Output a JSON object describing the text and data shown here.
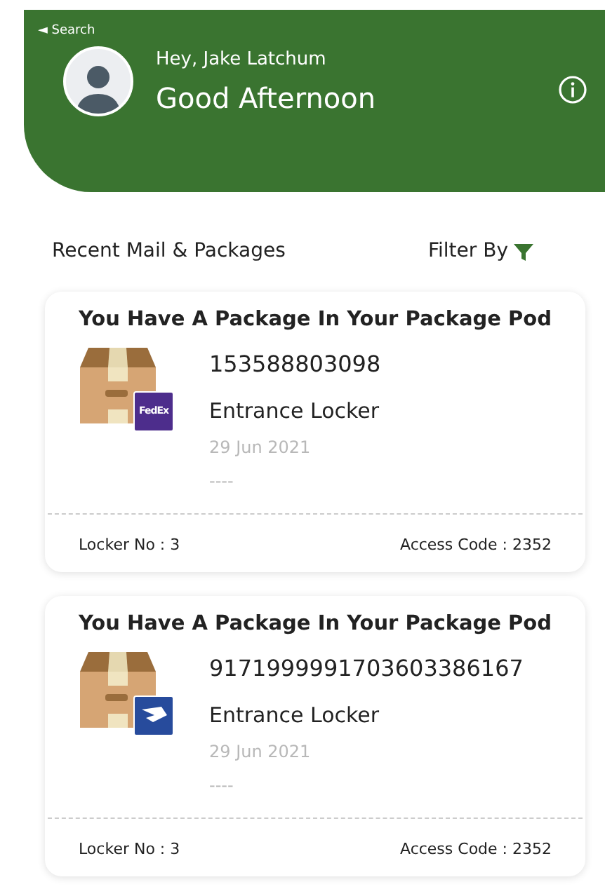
{
  "status_bar": {
    "back_label": "◄ Search"
  },
  "header": {
    "greeting": "Hey, Jake Latchum",
    "salutation": "Good Afternoon"
  },
  "section": {
    "title": "Recent Mail & Packages",
    "filter_label": "Filter By"
  },
  "packages": [
    {
      "title": "You Have A Package In Your Package Pod",
      "tracking": "153588803098",
      "location": "Entrance Locker",
      "date": "29 Jun 2021",
      "note": "----",
      "carrier": {
        "kind": "fedex",
        "label": "FedEx"
      },
      "locker": "Locker No : 3",
      "access_code": "Access Code : 2352"
    },
    {
      "title": "You Have A Package In Your Package Pod",
      "tracking": "9171999991703603386167",
      "location": "Entrance Locker",
      "date": "29 Jun 2021",
      "note": "----",
      "carrier": {
        "kind": "usps"
      },
      "locker": "Locker No : 3",
      "access_code": "Access Code : 2352"
    }
  ]
}
